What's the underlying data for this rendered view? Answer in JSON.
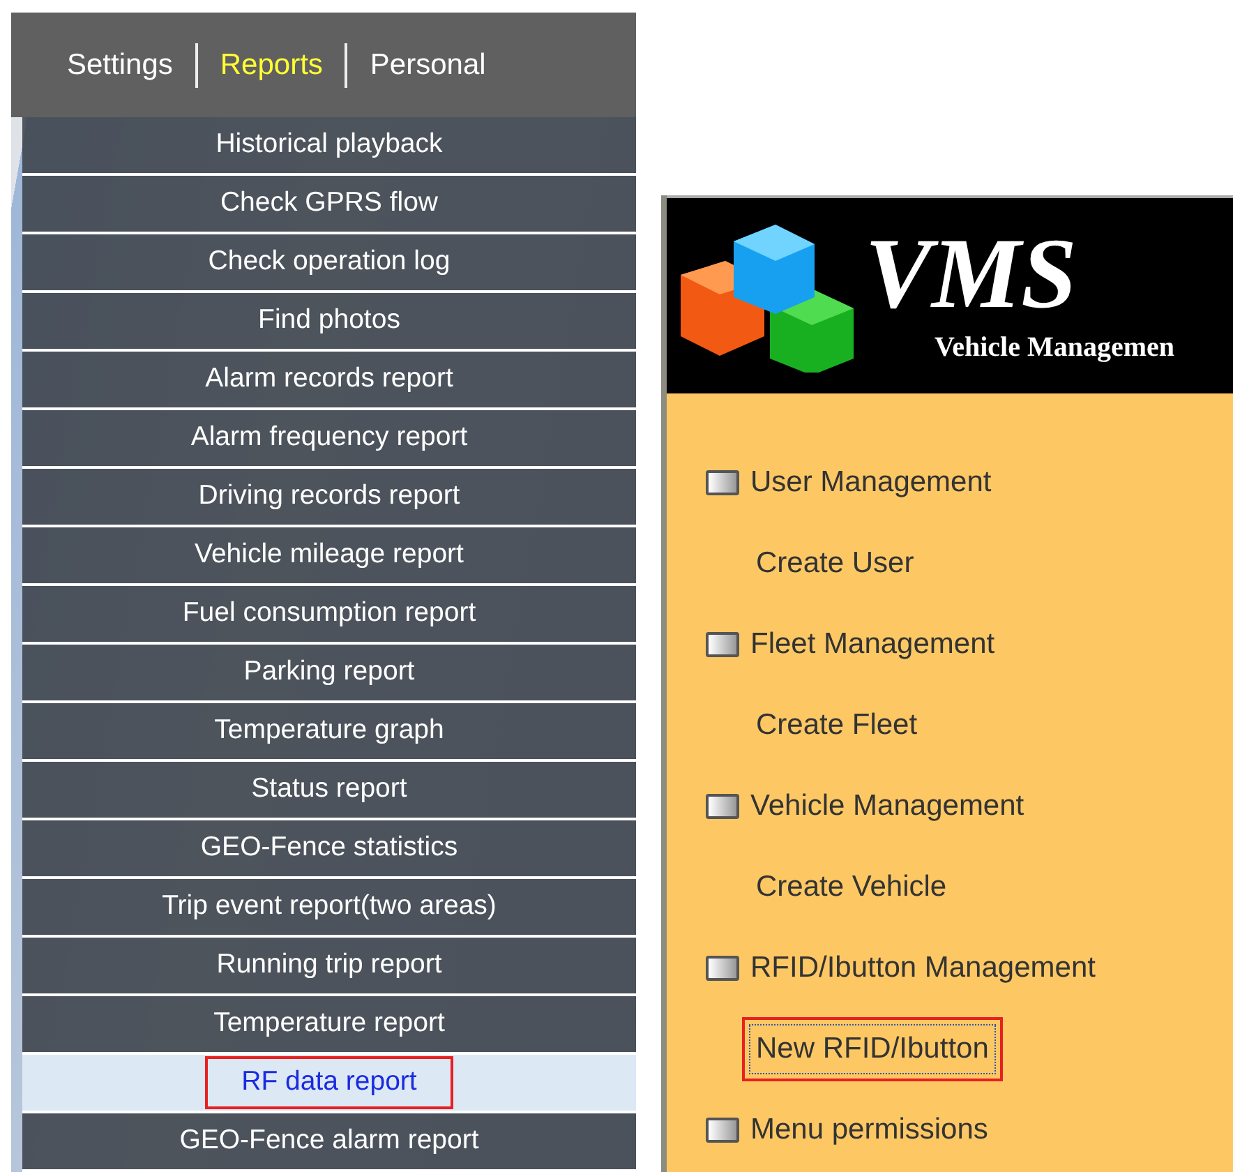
{
  "top_menu": [
    {
      "label": "Settings",
      "selected": false
    },
    {
      "label": "Reports",
      "selected": true
    },
    {
      "label": "Personal",
      "selected": false
    }
  ],
  "reports_menu": [
    {
      "label": "Historical playback",
      "selected": false
    },
    {
      "label": "Check GPRS flow",
      "selected": false
    },
    {
      "label": "Check operation log",
      "selected": false
    },
    {
      "label": "Find photos",
      "selected": false
    },
    {
      "label": "Alarm records report",
      "selected": false
    },
    {
      "label": "Alarm frequency report",
      "selected": false
    },
    {
      "label": "Driving records report",
      "selected": false
    },
    {
      "label": "Vehicle mileage report",
      "selected": false
    },
    {
      "label": "Fuel consumption report",
      "selected": false
    },
    {
      "label": "Parking report",
      "selected": false
    },
    {
      "label": "Temperature graph",
      "selected": false
    },
    {
      "label": "Status report",
      "selected": false
    },
    {
      "label": "GEO-Fence statistics",
      "selected": false
    },
    {
      "label": "Trip event report(two areas)",
      "selected": false
    },
    {
      "label": "Running trip report",
      "selected": false
    },
    {
      "label": "Temperature report",
      "selected": false
    },
    {
      "label": "RF data report",
      "selected": true
    },
    {
      "label": "GEO-Fence alarm report",
      "selected": false
    }
  ],
  "vms_panel": {
    "logo_title": "VMS",
    "logo_subtitle": "Vehicle Managemen",
    "sections": [
      {
        "label": "User Management",
        "children": [
          {
            "label": "Create User",
            "selected": false
          }
        ]
      },
      {
        "label": "Fleet Management",
        "children": [
          {
            "label": "Create Fleet",
            "selected": false
          }
        ]
      },
      {
        "label": "Vehicle Management",
        "children": [
          {
            "label": "Create Vehicle",
            "selected": false
          }
        ]
      },
      {
        "label": "RFID/Ibutton Management",
        "children": [
          {
            "label": "New RFID/Ibutton",
            "selected": true
          }
        ]
      },
      {
        "label": "Menu permissions"
      }
    ]
  }
}
